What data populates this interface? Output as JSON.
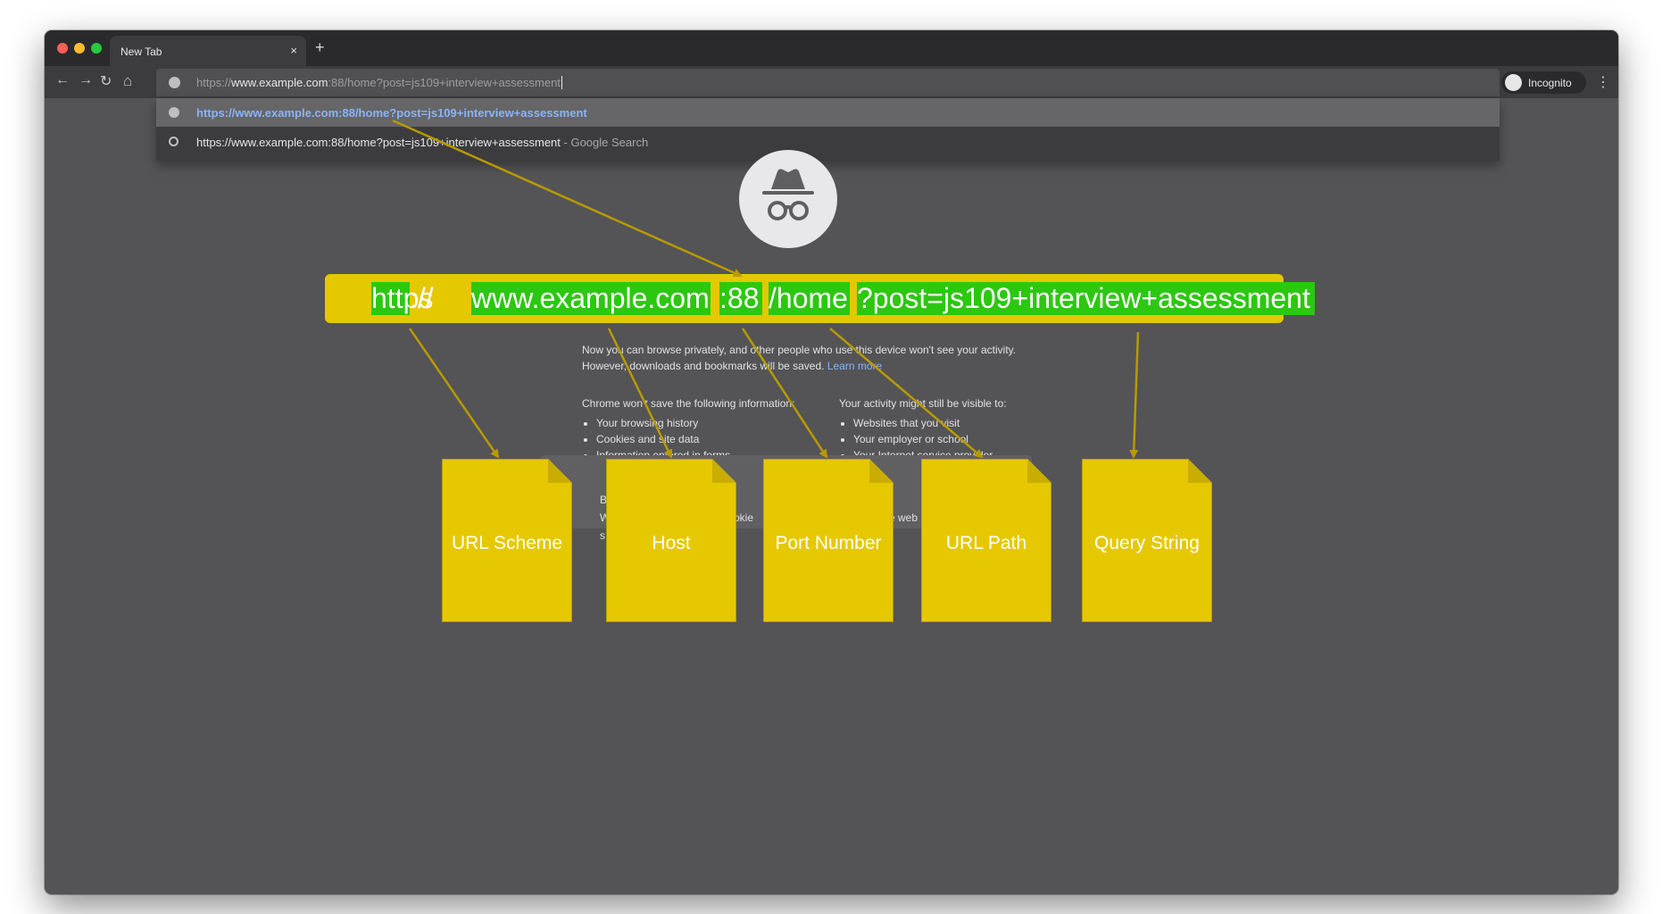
{
  "browser": {
    "tab_title": "New Tab",
    "tab_close_glyph": "×",
    "new_tab_glyph": "+",
    "nav": {
      "back_glyph": "←",
      "forward_glyph": "→",
      "reload_glyph": "↻",
      "home_glyph": "⌂"
    },
    "omnibox": {
      "scheme_part": "https://",
      "host_part": "www.example.com",
      "rest_part": ":88/home?post=js109+interview+assessment"
    },
    "suggestions": [
      {
        "text": "https://www.example.com:88/home?post=js109+interview+assessment",
        "suffix": ""
      },
      {
        "text": "https://www.example.com:88/home?post=js109+interview+assessment",
        "suffix": " - Google Search"
      }
    ],
    "profile_label": "Incognito",
    "menu_glyph": "⋮",
    "icons": {
      "site": "globe-icon",
      "search": "search-icon",
      "profile": "incognito-icon"
    }
  },
  "page": {
    "intro_line1": "Now you can browse privately, and other people who use this device won't see your activity.",
    "intro_line2": "However, downloads and bookmarks will be saved.",
    "learn_more": "Learn more",
    "left_heading": "Chrome won't save the following information:",
    "left_items": [
      "Your browsing history",
      "Cookies and site data",
      "Information entered in forms"
    ],
    "right_heading": "Your activity might still be visible to:",
    "right_items": [
      "Websites that you visit",
      "Your employer or school",
      "Your Internet service provider"
    ],
    "cookie_fragments": {
      "a": "B",
      "b": "W",
      "c": "s",
      "d": "okie",
      "e": "e web"
    }
  },
  "annotation": {
    "url_segments": {
      "scheme": "https",
      "scheme_sep": "://",
      "host": "www.example.com",
      "port": ":88",
      "path": "/home",
      "query": "?post=js109+interview+assessment"
    },
    "notes": [
      "URL Scheme",
      "Host",
      "Port Number",
      "URL Path",
      "Query String"
    ],
    "colors": {
      "note": "#e6c800",
      "segment": "#2bc80f",
      "arrow": "#b89a00",
      "banner": "#e4c800"
    }
  }
}
